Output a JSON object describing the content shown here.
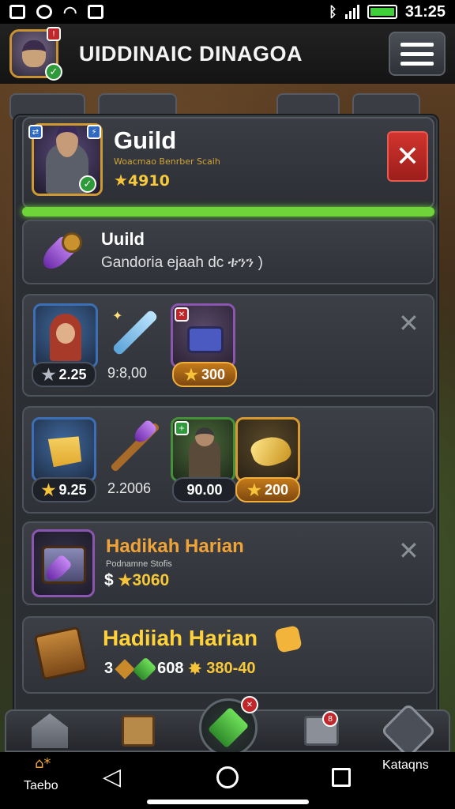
{
  "status_bar": {
    "time": "31:25"
  },
  "top_bar": {
    "title": "UIDDINAIC DINAGOA"
  },
  "guild_header": {
    "title": "Guild",
    "subtitle": "Woacmao Benrber Scaih",
    "score": "4910"
  },
  "guild_row": {
    "title": "Uuild",
    "subtitle": "Gandoria ejaah dc ቱንን )"
  },
  "row_a": {
    "items": [
      {
        "label": "2.25",
        "icon": "hero-portrait"
      },
      {
        "label": "9:8,00",
        "icon": "sword-icon"
      },
      {
        "label": "300",
        "icon": "armor-icon"
      }
    ]
  },
  "row_b": {
    "items": [
      {
        "label": "9.25",
        "icon": "gold-shard-icon"
      },
      {
        "label": "2.2006",
        "icon": "staff-icon"
      },
      {
        "label": "90.00",
        "icon": "warrior-portrait"
      },
      {
        "label": "200",
        "icon": "horn-icon"
      }
    ]
  },
  "reward_a": {
    "title": "Hadikah Harian",
    "subtitle": "Podnamne Stofis",
    "currency": "$",
    "value": "3060"
  },
  "reward_b": {
    "title": "Hadiiah Harian",
    "prefix": "3",
    "gem_value": "608",
    "value": "380-40"
  },
  "bottom_nav": {
    "home_label": "Taebo",
    "right_label": "Kataqns"
  },
  "colors": {
    "accent_green": "#6fd43a",
    "close_red": "#d2342e",
    "gold_text": "#f6c83a",
    "orange_title": "#f0a438",
    "yellow_title": "#ffd23a"
  }
}
